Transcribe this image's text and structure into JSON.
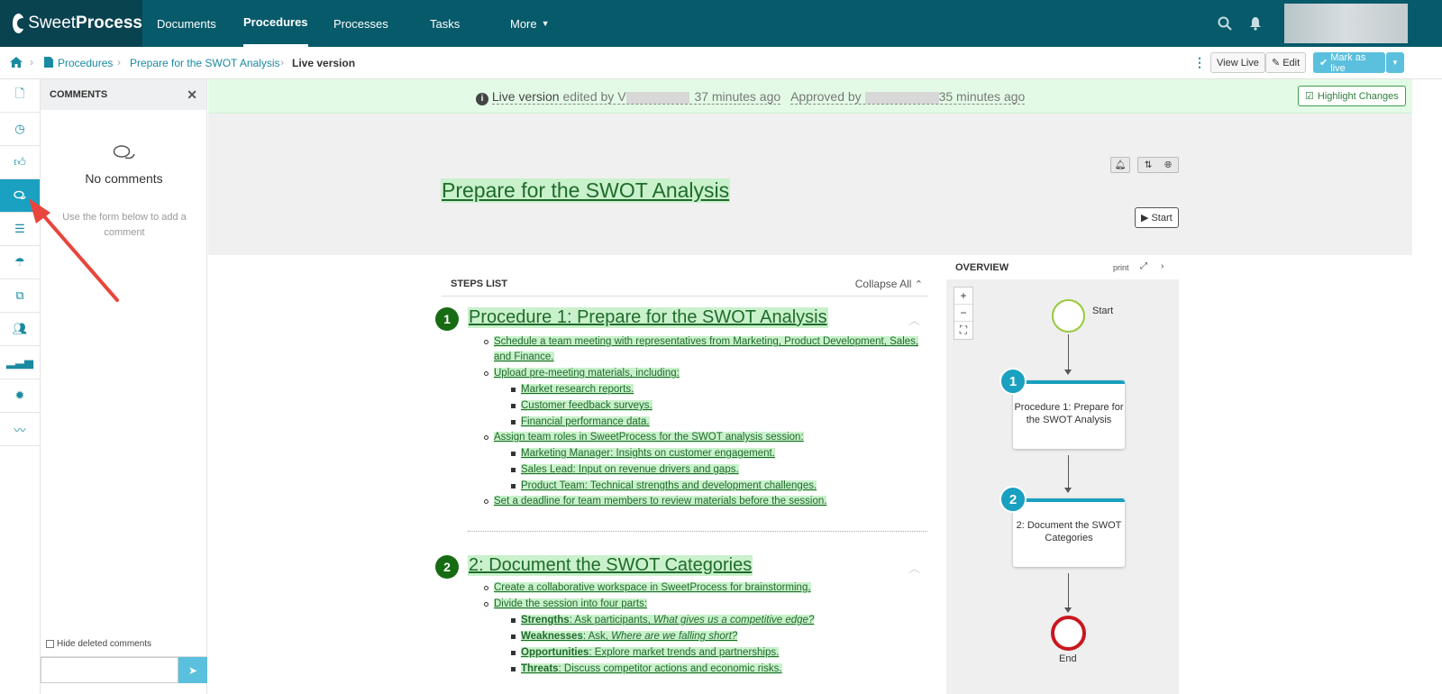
{
  "app": {
    "brand_light": "Sweet",
    "brand_bold": "Process"
  },
  "nav": {
    "items": [
      {
        "label": "Documents"
      },
      {
        "label": "Procedures"
      },
      {
        "label": "Processes"
      },
      {
        "label": "Tasks"
      },
      {
        "label": "More"
      }
    ],
    "active": "Procedures"
  },
  "breadcrumb": {
    "items": [
      "Procedures",
      "Prepare for the SWOT Analysis",
      "Live version"
    ]
  },
  "toolbar": {
    "view_live": "View Live",
    "edit": "Edit",
    "mark_as_live": "Mark as live"
  },
  "comments": {
    "title": "COMMENTS",
    "empty_title": "No comments",
    "empty_hint": "Use the form below to add a comment",
    "hide_deleted": "Hide deleted comments"
  },
  "live_bar": {
    "live_version": "Live version",
    "edited_by": "edited by",
    "edited_by_initial": "V",
    "edited_ago": "37 minutes ago",
    "approved_by": "Approved by",
    "approved_ago": "35 minutes ago",
    "highlight": "Highlight Changes"
  },
  "procedure": {
    "title": "Prepare for the SWOT Analysis",
    "start_label": "Start"
  },
  "steps": {
    "header": "STEPS LIST",
    "collapse_all": "Collapse All",
    "list": [
      {
        "num": "1",
        "title": "Procedure 1: Prepare for the SWOT Analysis",
        "items": [
          "Schedule a team meeting with representatives from Marketing, Product Development, Sales,",
          "and Finance.",
          "Upload pre-meeting materials, including:",
          "Market research reports.",
          "Customer feedback surveys.",
          "Financial performance data.",
          "Assign team roles in SweetProcess for the SWOT analysis session:",
          "Marketing Manager: Insights on customer engagement.",
          "Sales Lead: Input on revenue drivers and gaps.",
          "Product Team: Technical strengths and development challenges.",
          "Set a deadline for team members to review materials before the session."
        ]
      },
      {
        "num": "2",
        "title": "2: Document the SWOT Categories",
        "items": [
          "Create a collaborative workspace in SweetProcess for brainstorming.",
          "Divide the session into four parts:"
        ],
        "sub": [
          {
            "bold": "Strengths",
            "text": ": Ask participants, ",
            "italic": "What gives us a competitive edge?"
          },
          {
            "bold": "Weaknesses",
            "text": ": Ask, ",
            "italic": "Where are we falling short?"
          },
          {
            "bold": "Opportunities",
            "text": ": Explore market trends and partnerships.",
            "italic": ""
          },
          {
            "bold": "Threats",
            "text": ": Discuss competitor actions and economic risks.",
            "italic": ""
          }
        ]
      }
    ]
  },
  "overview": {
    "title": "OVERVIEW",
    "print": "print",
    "start": "Start",
    "end": "End",
    "nodes": [
      {
        "num": "1",
        "label": "Procedure 1: Prepare for the SWOT Analysis"
      },
      {
        "num": "2",
        "label": "2: Document the SWOT Categories"
      }
    ],
    "zoom": [
      "+",
      "−",
      "⛶"
    ]
  },
  "colors": {
    "nav_bg": "#075a6a",
    "accent": "#1aa0c0",
    "highlight_green": "#c9f1cc",
    "start_node": "#97c93d",
    "end_node": "#c9171f",
    "annotation_arrow": "#e8453c"
  }
}
